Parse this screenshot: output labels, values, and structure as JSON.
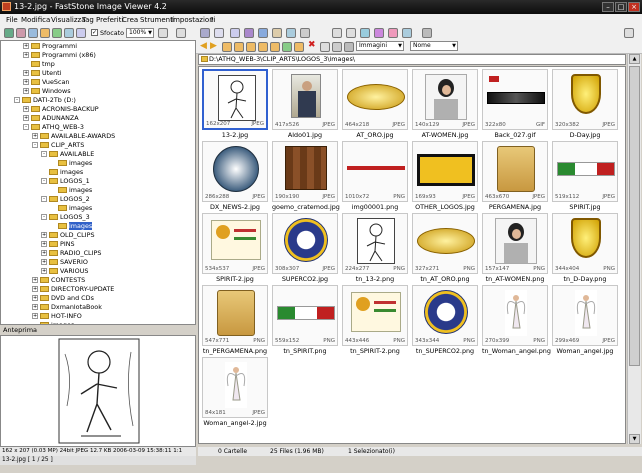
{
  "window": {
    "title": "13-2.jpg - FastStone Image Viewer 4.2"
  },
  "menu": [
    "File",
    "Modifica",
    "Visualizza",
    "Tag",
    "Preferiti",
    "Crea",
    "Strumenti",
    "Impostazioni",
    "?"
  ],
  "toolbar": {
    "blur_label": "Sfocato",
    "zoom_value": "100%"
  },
  "filters": {
    "images": "Immagini",
    "sort": "Nome"
  },
  "path": "D:\\ATHQ_WEB-3\\CLIP_ARTS\\LOGOS_3\\images\\",
  "tree": [
    {
      "label": "Programmi",
      "depth": 2,
      "exp": "+"
    },
    {
      "label": "Programmi (x86)",
      "depth": 2,
      "exp": "+"
    },
    {
      "label": "tmp",
      "depth": 2,
      "exp": ""
    },
    {
      "label": "Utenti",
      "depth": 2,
      "exp": "+"
    },
    {
      "label": "VueScan",
      "depth": 2,
      "exp": "+"
    },
    {
      "label": "Windows",
      "depth": 2,
      "exp": "+"
    },
    {
      "label": "DATI-2Tb (D:)",
      "depth": 1,
      "exp": "-"
    },
    {
      "label": "ACRONIS-BACKUP",
      "depth": 2,
      "exp": "+"
    },
    {
      "label": "ADUNANZA",
      "depth": 2,
      "exp": "+"
    },
    {
      "label": "ATHQ_WEB-3",
      "depth": 2,
      "exp": "-"
    },
    {
      "label": "AVAILABLE-AWARDS",
      "depth": 3,
      "exp": "+"
    },
    {
      "label": "CLIP_ARTS",
      "depth": 3,
      "exp": "-"
    },
    {
      "label": "AVAILABLE",
      "depth": 4,
      "exp": "-"
    },
    {
      "label": "images",
      "depth": 5,
      "exp": ""
    },
    {
      "label": "images",
      "depth": 4,
      "exp": ""
    },
    {
      "label": "LOGOS_1",
      "depth": 4,
      "exp": "-"
    },
    {
      "label": "images",
      "depth": 5,
      "exp": ""
    },
    {
      "label": "LOGOS_2",
      "depth": 4,
      "exp": "-"
    },
    {
      "label": "images",
      "depth": 5,
      "exp": ""
    },
    {
      "label": "LOGOS_3",
      "depth": 4,
      "exp": "-"
    },
    {
      "label": "images",
      "depth": 5,
      "exp": "",
      "selected": true
    },
    {
      "label": "OLD_CLIPS",
      "depth": 4,
      "exp": "+"
    },
    {
      "label": "PINS",
      "depth": 4,
      "exp": "+"
    },
    {
      "label": "RADIO_CLIPS",
      "depth": 4,
      "exp": "+"
    },
    {
      "label": "SAVERIO",
      "depth": 4,
      "exp": "+"
    },
    {
      "label": "VARIOUS",
      "depth": 4,
      "exp": "+"
    },
    {
      "label": "CONTESTS",
      "depth": 3,
      "exp": "+"
    },
    {
      "label": "DIRECTORY-UPDATE",
      "depth": 3,
      "exp": "+"
    },
    {
      "label": "DVD and CDs",
      "depth": 3,
      "exp": "+"
    },
    {
      "label": "DxmanlotaBook",
      "depth": 3,
      "exp": "+"
    },
    {
      "label": "HOT-INFO",
      "depth": 3,
      "exp": "+"
    },
    {
      "label": "images",
      "depth": 3,
      "exp": ""
    }
  ],
  "preview": {
    "label": "Anteprima"
  },
  "info": {
    "text": "162 x 207 (0.03 MP)  24bit JPEG  12.7 KB  2006-03-09 15:38:11  1:1"
  },
  "file": {
    "text": "13-2.jpg [ 1 / 25 ]"
  },
  "thumbs": [
    {
      "name": "13-2.jpg",
      "dim": "162x207",
      "fmt": "JPEG",
      "kind": "sketch",
      "selected": true
    },
    {
      "name": "Aldo01.jpg",
      "dim": "417x526",
      "fmt": "JPEG",
      "kind": "photo"
    },
    {
      "name": "AT_ORO.jpg",
      "dim": "464x218",
      "fmt": "JPEG",
      "kind": "goldoval"
    },
    {
      "name": "AT-WOMEN.jpg",
      "dim": "140x129",
      "fmt": "JPEG",
      "kind": "portrait"
    },
    {
      "name": "Back_027.gif",
      "dim": "322x80",
      "fmt": "GIF",
      "kind": "back"
    },
    {
      "name": "D-Day.jpg",
      "dim": "320x382",
      "fmt": "JPEG",
      "kind": "shield"
    },
    {
      "name": "DX_NEWS-2.jpg",
      "dim": "286x288",
      "fmt": "JPEG",
      "kind": "badge"
    },
    {
      "name": "goemo_cratemod.jpg",
      "dim": "190x190",
      "fmt": "JPEG",
      "kind": "wood"
    },
    {
      "name": "img00001.png",
      "dim": "1010x72",
      "fmt": "PNG",
      "kind": "redline"
    },
    {
      "name": "OTHER_LOGOS.jpg",
      "dim": "169x93",
      "fmt": "JPEG",
      "kind": "otherlogos"
    },
    {
      "name": "PERGAMENA.jpg",
      "dim": "463x670",
      "fmt": "JPEG",
      "kind": "scroll"
    },
    {
      "name": "SPIRIT.jpg",
      "dim": "519x112",
      "fmt": "JPEG",
      "kind": "spirit"
    },
    {
      "name": "SPIRIT-2.jpg",
      "dim": "534x537",
      "fmt": "JPEG",
      "kind": "cert"
    },
    {
      "name": "SUPERCO2.jpg",
      "dim": "308x307",
      "fmt": "JPEG",
      "kind": "seal"
    },
    {
      "name": "tn_13-2.png",
      "dim": "224x277",
      "fmt": "PNG",
      "kind": "sketch"
    },
    {
      "name": "tn_AT_ORO.png",
      "dim": "327x271",
      "fmt": "PNG",
      "kind": "goldoval"
    },
    {
      "name": "tn_AT-WOMEN.png",
      "dim": "157x147",
      "fmt": "PNG",
      "kind": "portrait"
    },
    {
      "name": "tn_D-Day.png",
      "dim": "344x404",
      "fmt": "PNG",
      "kind": "shield"
    },
    {
      "name": "tn_PERGAMENA.png",
      "dim": "547x771",
      "fmt": "PNG",
      "kind": "scroll"
    },
    {
      "name": "tn_SPIRIT.png",
      "dim": "559x152",
      "fmt": "PNG",
      "kind": "spirit"
    },
    {
      "name": "tn_SPIRIT-2.png",
      "dim": "443x446",
      "fmt": "PNG",
      "kind": "cert"
    },
    {
      "name": "tn_SUPERCO2.png",
      "dim": "343x344",
      "fmt": "PNG",
      "kind": "seal"
    },
    {
      "name": "tn_Woman_angel.png",
      "dim": "270x399",
      "fmt": "PNG",
      "kind": "angel"
    },
    {
      "name": "Woman_angel.jpg",
      "dim": "299x469",
      "fmt": "JPEG",
      "kind": "angel"
    },
    {
      "name": "Woman_angel-2.jpg",
      "dim": "84x181",
      "fmt": "JPEG",
      "kind": "angel"
    }
  ],
  "status": {
    "folders": "0 Cartelle",
    "files": "25 Files (1.96 MB)",
    "selected": "1 Selezionato(i)"
  }
}
